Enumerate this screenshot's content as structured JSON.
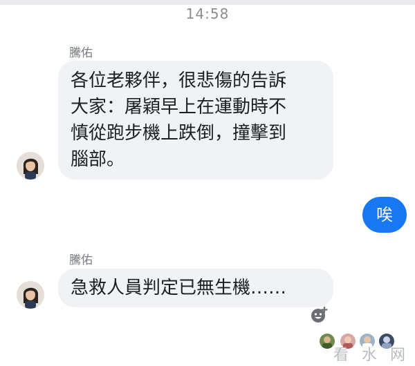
{
  "header": {
    "time": "14:58"
  },
  "messages": [
    {
      "sender": "騰佑",
      "lines": [
        "各位老夥伴，很悲傷的告訴",
        "大家：屠穎早上在運動時不",
        "慎從跑步機上跌倒，撞擊到",
        "腦部。"
      ]
    },
    {
      "outgoing": "唉"
    },
    {
      "sender": "騰佑",
      "text": "急救人員判定已無生機……"
    }
  ],
  "icons": {
    "avatar": "avatar-photo",
    "reaction": "add-reaction-icon",
    "seen": "seen-avatars"
  },
  "watermark": "看 水 网",
  "colors": {
    "outgoing_bubble": "#1877f2",
    "incoming_bubble": "#f0f2f5"
  }
}
